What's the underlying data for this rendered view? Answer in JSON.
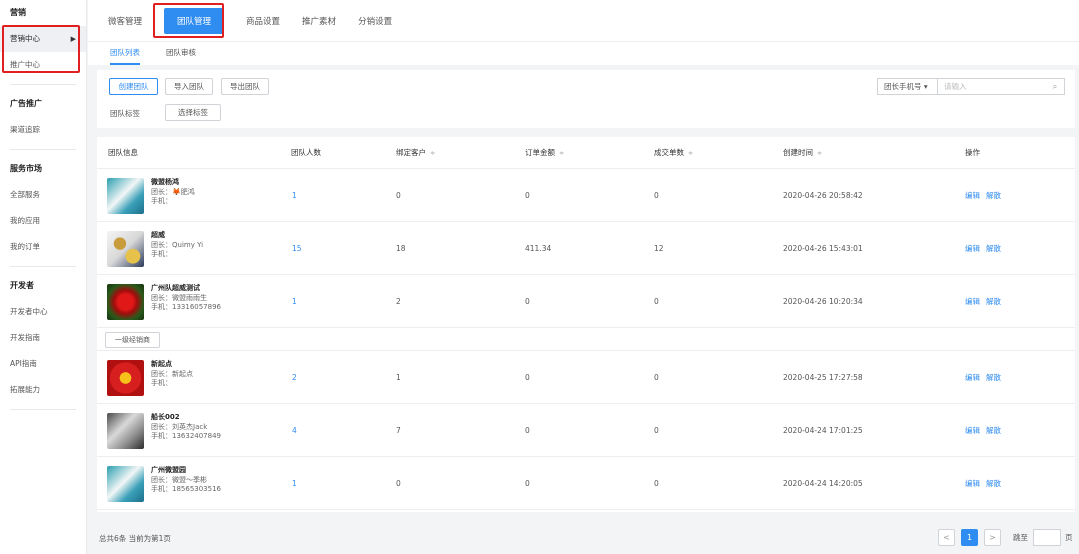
{
  "sidebar": {
    "section_marketing": "营销",
    "item_marketing_center": "营销中心",
    "item_promo_center": "推广中心",
    "section_ads": "广告推广",
    "item_channel_tracking": "渠道追踪",
    "section_service": "服务市场",
    "item_all_services": "全部服务",
    "item_my_apps": "我的应用",
    "item_my_orders": "我的订单",
    "section_developer": "开发者",
    "item_dev_center": "开发者中心",
    "item_dev_guide": "开发指南",
    "item_api_guide": "API指南",
    "item_extension": "拓展能力",
    "arrow": "▶"
  },
  "top_tabs": [
    "微客管理",
    "团队管理",
    "商品设置",
    "推广素材",
    "分销设置"
  ],
  "sub_tabs": [
    "团队列表",
    "团队审核"
  ],
  "toolbar": {
    "create_team": "创建团队",
    "import_team": "导入团队",
    "export_team": "导出团队",
    "team_tag_label": "团队标签",
    "select_tag": "选择标签",
    "search_select": "团长手机号",
    "search_placeholder": "请输入"
  },
  "table": {
    "headers": [
      "团队信息",
      "团队人数",
      "绑定客户",
      "订单金额",
      "成交单数",
      "创建时间",
      "操作"
    ],
    "ops": {
      "edit": "编辑",
      "dissolve": "解散"
    },
    "rows": [
      {
        "name": "微盟杨鸿",
        "leader": "团长：🦊肥鸿",
        "phone": "手机：",
        "members": "1",
        "customers": "0",
        "amount": "0",
        "deals": "0",
        "created": "2020-04-26 20:58:42"
      },
      {
        "name": "超威",
        "leader": "团长：Quimy Yi",
        "phone": "手机：",
        "members": "15",
        "customers": "18",
        "amount": "411.34",
        "deals": "12",
        "created": "2020-04-26 15:43:01"
      },
      {
        "name": "广州队超威测试",
        "leader": "团长：微盟雨雨生",
        "phone": "手机：13316057896",
        "members": "1",
        "customers": "2",
        "amount": "0",
        "deals": "0",
        "created": "2020-04-26 10:20:34"
      },
      {
        "name": "新起点",
        "leader": "团长：新起点",
        "phone": "手机：",
        "members": "2",
        "customers": "1",
        "amount": "0",
        "deals": "0",
        "created": "2020-04-25 17:27:58"
      },
      {
        "name": "船长002",
        "leader": "团长：刘英杰Jack",
        "phone": "手机：13632407849",
        "members": "4",
        "customers": "7",
        "amount": "0",
        "deals": "0",
        "created": "2020-04-24 17:01:25"
      },
      {
        "name": "广州微盟园",
        "leader": "团长：微盟～季彬",
        "phone": "手机：18565303516",
        "members": "1",
        "customers": "0",
        "amount": "0",
        "deals": "0",
        "created": "2020-04-24 14:20:05"
      }
    ],
    "tag_row_label": "一级经销商"
  },
  "footer": {
    "summary": "总共6条 当前为第1页",
    "page": "1",
    "goto_label": "跳至",
    "page_unit": "页",
    "prev": "<",
    "next": ">"
  },
  "colors": {
    "accent": "#2f8cf0",
    "highlight": "#e02020"
  }
}
